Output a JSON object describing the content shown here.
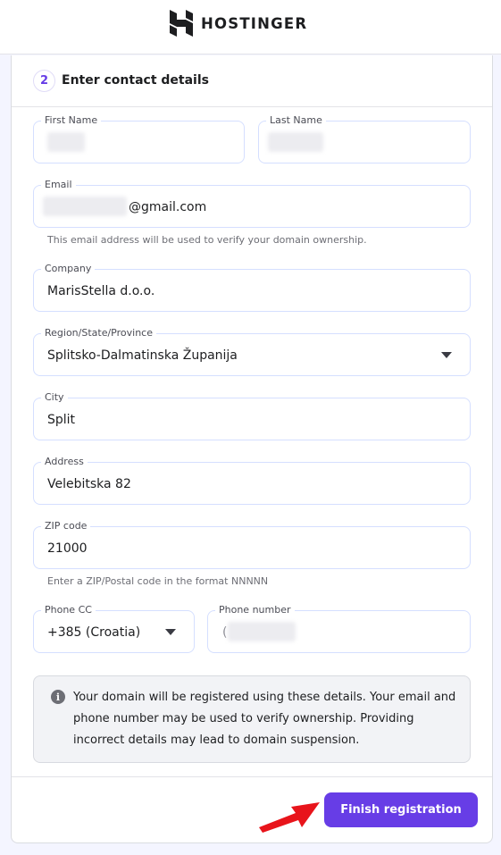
{
  "brand": {
    "name": "HOSTINGER"
  },
  "step": {
    "number": "2",
    "title": "Enter contact details"
  },
  "fields": {
    "first_name": {
      "label": "First Name",
      "value": ""
    },
    "last_name": {
      "label": "Last Name",
      "value": ""
    },
    "email": {
      "label": "Email",
      "suffix": "@gmail.com",
      "hint": "This email address will be used to verify your domain ownership."
    },
    "company": {
      "label": "Company",
      "value": "MarisStella d.o.o."
    },
    "region": {
      "label": "Region/State/Province",
      "value": "Splitsko-Dalmatinska Županija"
    },
    "city": {
      "label": "City",
      "value": "Split"
    },
    "address": {
      "label": "Address",
      "value": "Velebitska 82"
    },
    "zip": {
      "label": "ZIP code",
      "value": "21000",
      "hint": "Enter a ZIP/Postal code in the format NNNNN"
    },
    "phone_cc": {
      "label": "Phone CC",
      "value": "+385 (Croatia)"
    },
    "phone_number": {
      "label": "Phone number",
      "value": "("
    }
  },
  "info": {
    "text": "Your domain will be registered using these details. Your email and phone number may be used to verify ownership. Providing incorrect details may lead to domain suspension."
  },
  "actions": {
    "finish_label": "Finish registration"
  },
  "colors": {
    "accent": "#673de6",
    "arrow": "#e8141b"
  }
}
